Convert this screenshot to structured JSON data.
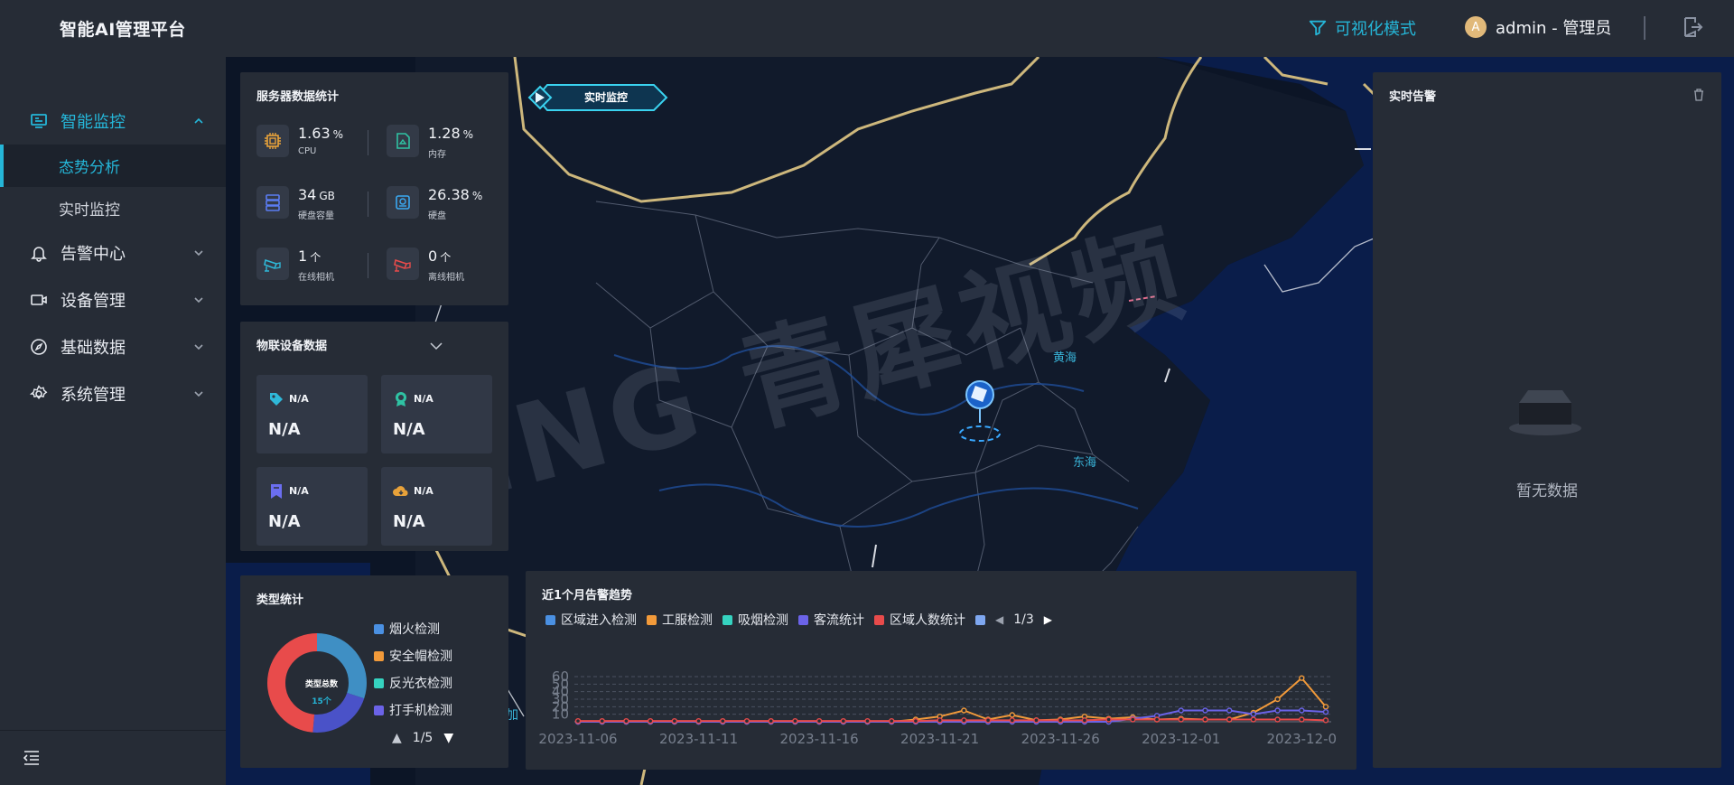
{
  "header": {
    "brand": "智能AI管理平台",
    "visual_mode": "可视化模式",
    "avatar_letter": "A",
    "user": "admin - 管理员"
  },
  "sidebar": {
    "items": [
      {
        "label": "智能监控",
        "icon": "monitor-icon",
        "expanded": true,
        "children": [
          {
            "label": "态势分析",
            "active": true
          },
          {
            "label": "实时监控",
            "active": false
          }
        ]
      },
      {
        "label": "告警中心",
        "icon": "bell-icon"
      },
      {
        "label": "设备管理",
        "icon": "camera-device-icon"
      },
      {
        "label": "基础数据",
        "icon": "compass-icon"
      },
      {
        "label": "系统管理",
        "icon": "gear-icon"
      }
    ]
  },
  "map": {
    "realtime_tag": "实时监控",
    "labels": {
      "yellow_sea": "黄海",
      "east_sea": "东海",
      "partial": "加"
    },
    "watermark": "TSING 青犀视频"
  },
  "server": {
    "title": "服务器数据统计",
    "metrics": [
      {
        "value": "1.63",
        "unit": "%",
        "label": "CPU",
        "icon": "cpu-icon",
        "color": "#e8a23a"
      },
      {
        "value": "1.28",
        "unit": "%",
        "label": "内存",
        "icon": "memory-card-icon",
        "color": "#2fc2a3"
      },
      {
        "value": "34",
        "unit": "GB",
        "label": "硬盘容量",
        "icon": "server-stack-icon",
        "color": "#5b7cf2"
      },
      {
        "value": "26.38",
        "unit": "%",
        "label": "硬盘",
        "icon": "hard-disk-icon",
        "color": "#3aa9f2"
      },
      {
        "value": "1",
        "unit": "个",
        "label": "在线相机",
        "icon": "online-camera-icon",
        "color": "#2fb8d8"
      },
      {
        "value": "0",
        "unit": "个",
        "label": "离线相机",
        "icon": "offline-camera-icon",
        "color": "#e84b4b"
      }
    ]
  },
  "iot": {
    "title": "物联设备数据",
    "cards": [
      {
        "name": "N/A",
        "value": "N/A",
        "icon": "tag-icon",
        "color": "#2fb8d8"
      },
      {
        "name": "N/A",
        "value": "N/A",
        "icon": "badge-icon",
        "color": "#2fc2a3"
      },
      {
        "name": "N/A",
        "value": "N/A",
        "icon": "bookmark-icon",
        "color": "#6b6ef0"
      },
      {
        "name": "N/A",
        "value": "N/A",
        "icon": "cloud-icon",
        "color": "#e8a23a"
      }
    ]
  },
  "types": {
    "title": "类型统计",
    "center_title": "类型总数",
    "center_value": "15个",
    "legend": [
      {
        "label": "烟火检测",
        "color": "#4a90e2"
      },
      {
        "label": "安全帽检测",
        "color": "#f29a3a"
      },
      {
        "label": "反光衣检测",
        "color": "#35d3c0"
      },
      {
        "label": "打手机检测",
        "color": "#6b63e8"
      }
    ],
    "pager": "1/5"
  },
  "trend": {
    "title": "近1个月告警趋势",
    "legend": [
      {
        "label": "区域进入检测",
        "color": "#4a90e2"
      },
      {
        "label": "工服检测",
        "color": "#f29a3a"
      },
      {
        "label": "吸烟检测",
        "color": "#35d3c0"
      },
      {
        "label": "客流统计",
        "color": "#6b63e8"
      },
      {
        "label": "区域人数统计",
        "color": "#e84b4b"
      }
    ],
    "extra_swatch_color": "#7ea7f0",
    "pager": "1/3"
  },
  "chart_data": {
    "type": "line",
    "x": [
      "2023-11-06",
      "2023-11-07",
      "2023-11-08",
      "2023-11-09",
      "2023-11-10",
      "2023-11-11",
      "2023-11-12",
      "2023-11-13",
      "2023-11-14",
      "2023-11-15",
      "2023-11-16",
      "2023-11-17",
      "2023-11-18",
      "2023-11-19",
      "2023-11-20",
      "2023-11-21",
      "2023-11-22",
      "2023-11-23",
      "2023-11-24",
      "2023-11-25",
      "2023-11-26",
      "2023-11-27",
      "2023-11-28",
      "2023-11-29",
      "2023-11-30",
      "2023-12-01",
      "2023-12-02",
      "2023-12-03",
      "2023-12-04",
      "2023-12-05",
      "2023-12-06",
      "2023-12-07"
    ],
    "x_tick_labels": [
      "2023-11-06",
      "2023-11-11",
      "2023-11-16",
      "2023-11-21",
      "2023-11-26",
      "2023-12-01",
      "2023-12-0"
    ],
    "y_ticks": [
      10,
      20,
      30,
      40,
      50,
      60
    ],
    "ylim": [
      0,
      60
    ],
    "series": [
      {
        "name": "工服检测",
        "color": "#f29a3a",
        "values": [
          0,
          0,
          0,
          0,
          0,
          0,
          0,
          0,
          0,
          0,
          0,
          0,
          0,
          0,
          3,
          7,
          15,
          3,
          9,
          2,
          3,
          7,
          4,
          6,
          3,
          4,
          3,
          3,
          12,
          30,
          58,
          20
        ]
      },
      {
        "name": "客流统计",
        "color": "#6b63e8",
        "values": [
          0,
          0,
          0,
          0,
          0,
          0,
          0,
          0,
          0,
          0,
          0,
          0,
          0,
          0,
          0,
          0,
          0,
          0,
          0,
          0,
          0,
          0,
          0,
          4,
          8,
          15,
          15,
          15,
          10,
          15,
          15,
          13
        ]
      },
      {
        "name": "区域人数统计",
        "color": "#e84b4b",
        "values": [
          1,
          1,
          1,
          1,
          1,
          1,
          1,
          1,
          1,
          1,
          1,
          1,
          1,
          1,
          1,
          2,
          2,
          2,
          2,
          2,
          2,
          2,
          3,
          3,
          3,
          3,
          3,
          3,
          3,
          3,
          3,
          2
        ]
      }
    ],
    "title": "近1个月告警趋势",
    "grid": true
  }
}
